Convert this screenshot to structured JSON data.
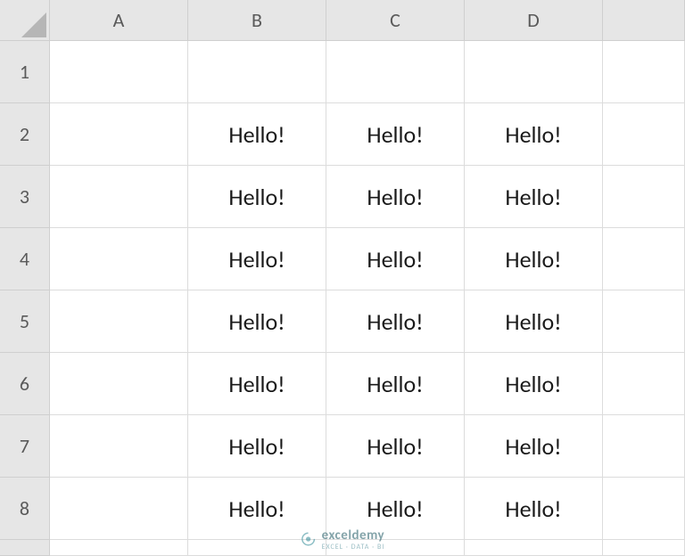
{
  "columns": [
    "A",
    "B",
    "C",
    "D",
    ""
  ],
  "rows": [
    "1",
    "2",
    "3",
    "4",
    "5",
    "6",
    "7",
    "8"
  ],
  "cells": {
    "r1": {
      "A": "",
      "B": "",
      "C": "",
      "D": "",
      "E": ""
    },
    "r2": {
      "A": "",
      "B": "Hello!",
      "C": "Hello!",
      "D": "Hello!",
      "E": ""
    },
    "r3": {
      "A": "",
      "B": "Hello!",
      "C": "Hello!",
      "D": "Hello!",
      "E": ""
    },
    "r4": {
      "A": "",
      "B": "Hello!",
      "C": "Hello!",
      "D": "Hello!",
      "E": ""
    },
    "r5": {
      "A": "",
      "B": "Hello!",
      "C": "Hello!",
      "D": "Hello!",
      "E": ""
    },
    "r6": {
      "A": "",
      "B": "Hello!",
      "C": "Hello!",
      "D": "Hello!",
      "E": ""
    },
    "r7": {
      "A": "",
      "B": "Hello!",
      "C": "Hello!",
      "D": "Hello!",
      "E": ""
    },
    "r8": {
      "A": "",
      "B": "Hello!",
      "C": "Hello!",
      "D": "Hello!",
      "E": ""
    }
  },
  "watermark": {
    "brand": "exceldemy",
    "sub": "EXCEL · DATA · BI"
  }
}
